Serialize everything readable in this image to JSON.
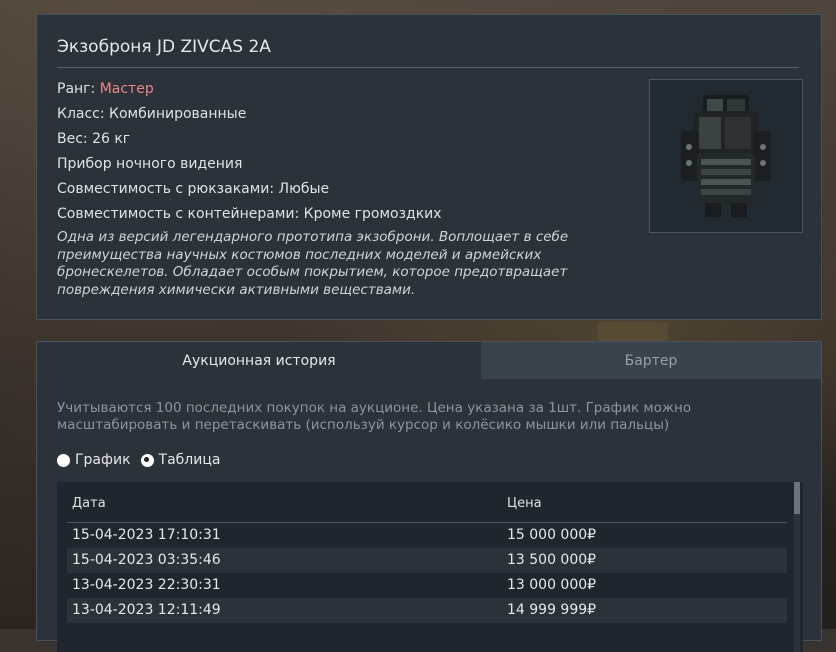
{
  "item": {
    "title": "Экзоброня JD ZIVCAS 2A",
    "rank_label": "Ранг: ",
    "rank_value": "Мастер",
    "class": "Класс: Комбинированные",
    "weight": "Вес: 26 кг",
    "feature": "Прибор ночного видения",
    "backpack_compat": "Совместимость с рюкзаками: Любые",
    "container_compat": "Совместимость с контейнерами: Кроме громоздких",
    "description": "Одна из версий легендарного прототипа экзоброни. Воплощает в себе преимущества научных костюмов последних моделей и армейских бронескелетов. Обладает особым покрытием, которое предотвращает повреждения химически активными веществами.",
    "image_icon": "exoskeleton-armor-icon"
  },
  "tabs": [
    {
      "label": "Аукционная история",
      "active": true
    },
    {
      "label": "Бартер",
      "active": false
    }
  ],
  "note": "Учитываются 100 последних покупок на аукционе. Цена указана за 1шт. График можно масштабировать и перетаскивать (используй курсор и колёсико мышки или пальцы)",
  "view_options": [
    {
      "label": "График",
      "checked": false
    },
    {
      "label": "Таблица",
      "checked": true
    }
  ],
  "table": {
    "headers": [
      "Дата",
      "Цена"
    ],
    "rows": [
      [
        "15-04-2023 17:10:31",
        "15 000 000₽"
      ],
      [
        "15-04-2023 03:35:46",
        "13 500 000₽"
      ],
      [
        "13-04-2023 22:30:31",
        "13 000 000₽"
      ],
      [
        "13-04-2023 12:11:49",
        "14 999 999₽"
      ]
    ]
  },
  "colors": {
    "rank_accent": "#e88787",
    "panel": "#2b3239",
    "inactive_tab": "#3a434c"
  }
}
